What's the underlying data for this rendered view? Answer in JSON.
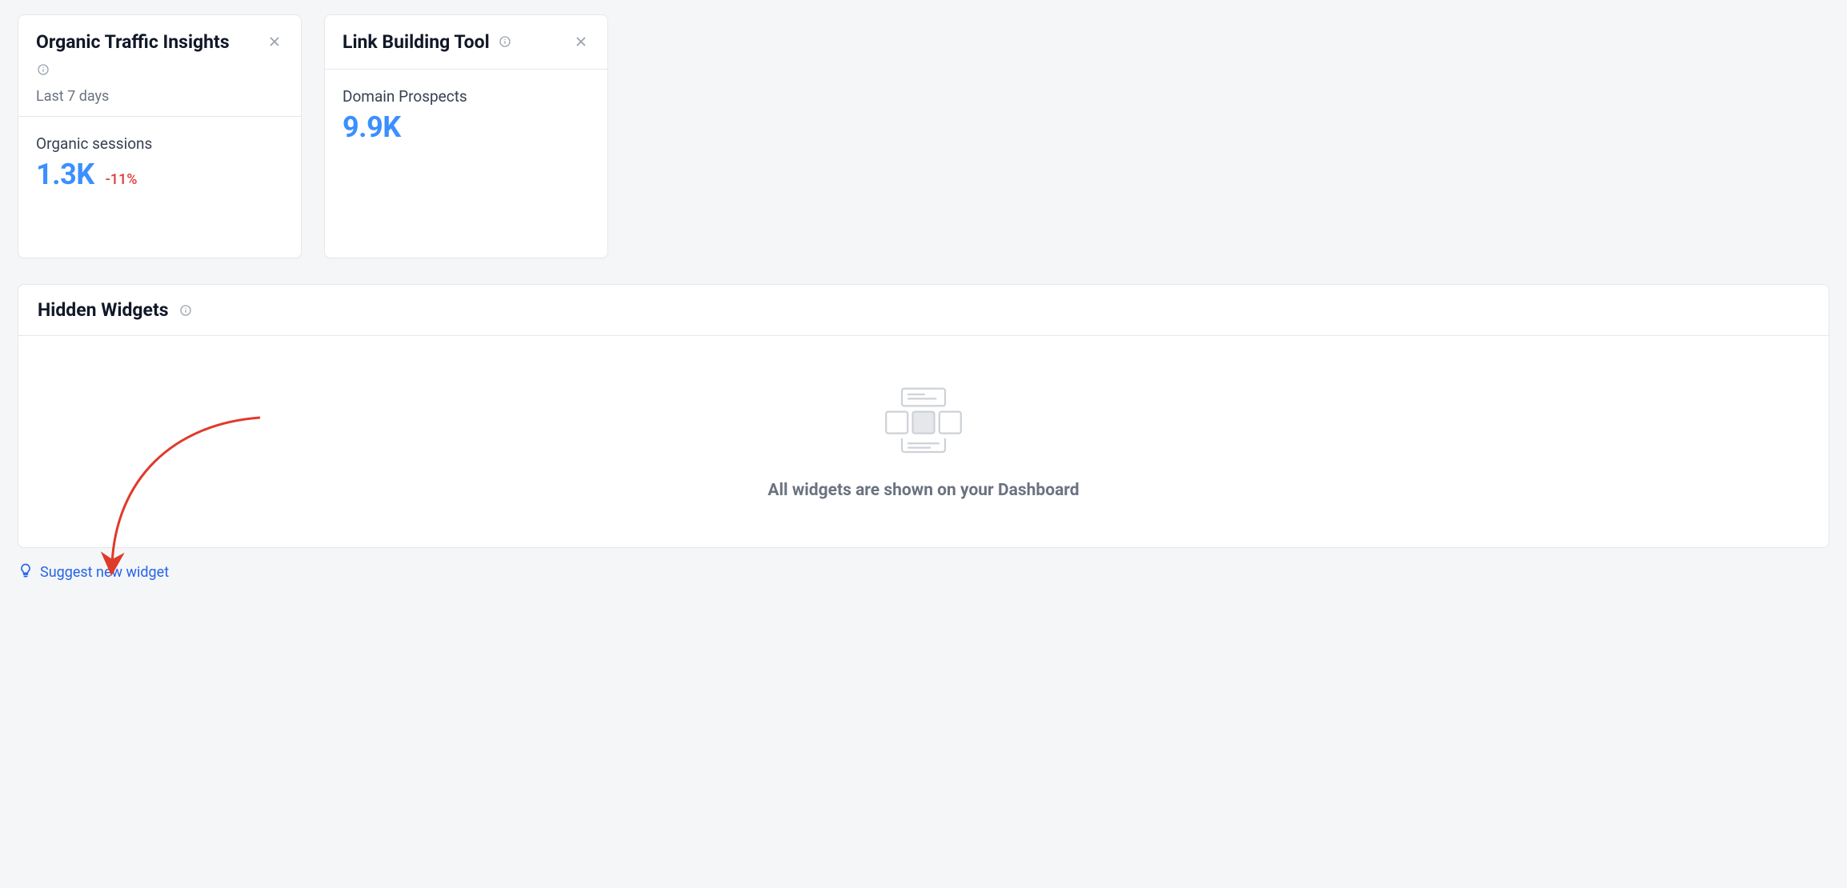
{
  "cards": {
    "organic": {
      "title": "Organic Traffic Insights",
      "subhead": "Last 7 days",
      "metric_label": "Organic sessions",
      "metric_value": "1.3K",
      "delta": "-11%"
    },
    "link": {
      "title": "Link Building Tool",
      "metric_label": "Domain Prospects",
      "metric_value": "9.9K"
    }
  },
  "hidden_panel": {
    "title": "Hidden Widgets",
    "empty_message": "All widgets are shown on your Dashboard"
  },
  "suggest_link": {
    "label": "Suggest new widget"
  }
}
